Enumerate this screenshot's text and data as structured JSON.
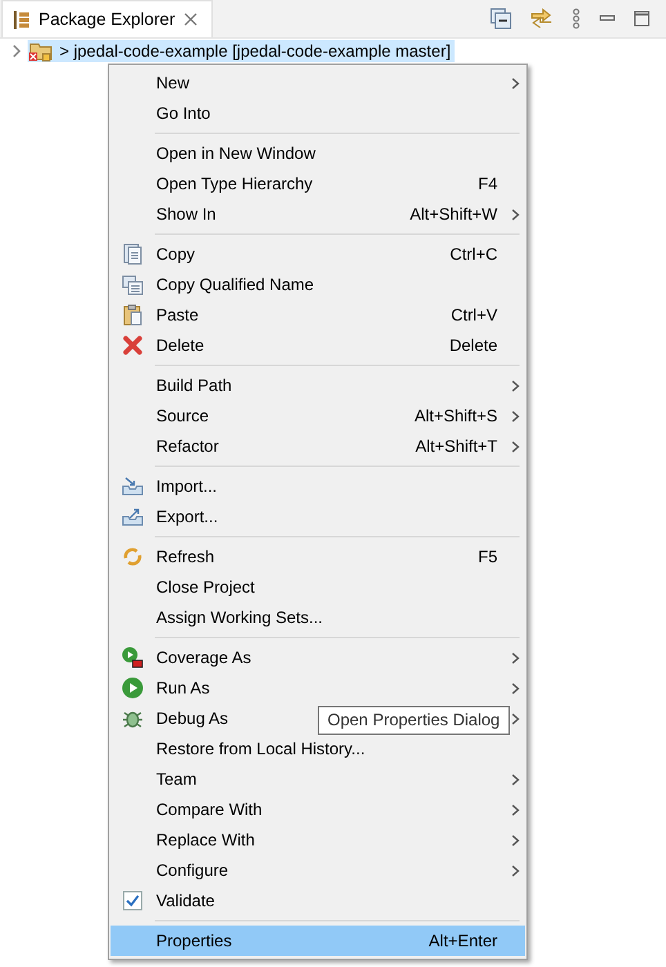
{
  "view": {
    "title": "Package Explorer"
  },
  "tree": [
    {
      "label": "> jpedal-code-example [jpedal-code-example master]",
      "selected": true,
      "expanded": false
    }
  ],
  "menu": {
    "groups": [
      [
        {
          "label": "New",
          "submenu": true,
          "selected": false
        },
        {
          "label": "Go Into",
          "selected": false
        }
      ],
      [
        {
          "label": "Open in New Window",
          "selected": false
        },
        {
          "label": "Open Type Hierarchy",
          "shortcut": "F4",
          "selected": false
        },
        {
          "label": "Show In",
          "shortcut": "Alt+Shift+W",
          "submenu": true,
          "selected": false
        }
      ],
      [
        {
          "label": "Copy",
          "shortcut": "Ctrl+C",
          "kind": "copy",
          "selected": false
        },
        {
          "label": "Copy Qualified Name",
          "kind": "copy-name",
          "selected": false
        },
        {
          "label": "Paste",
          "shortcut": "Ctrl+V",
          "kind": "paste",
          "selected": false
        },
        {
          "label": "Delete",
          "shortcut": "Delete",
          "kind": "delete",
          "selected": false
        }
      ],
      [
        {
          "label": "Build Path",
          "submenu": true,
          "selected": false
        },
        {
          "label": "Source",
          "shortcut": "Alt+Shift+S",
          "submenu": true,
          "selected": false
        },
        {
          "label": "Refactor",
          "shortcut": "Alt+Shift+T",
          "submenu": true,
          "selected": false
        }
      ],
      [
        {
          "label": "Import...",
          "kind": "import",
          "selected": false
        },
        {
          "label": "Export...",
          "kind": "export",
          "selected": false
        }
      ],
      [
        {
          "label": "Refresh",
          "shortcut": "F5",
          "kind": "refresh",
          "selected": false
        },
        {
          "label": "Close Project",
          "selected": false
        },
        {
          "label": "Assign Working Sets...",
          "selected": false
        }
      ],
      [
        {
          "label": "Coverage As",
          "kind": "coverage",
          "submenu": true,
          "selected": false
        },
        {
          "label": "Run As",
          "kind": "run",
          "submenu": true,
          "selected": false
        },
        {
          "label": "Debug As",
          "kind": "debug",
          "submenu": true,
          "selected": false
        },
        {
          "label": "Restore from Local History...",
          "selected": false
        },
        {
          "label": "Team",
          "submenu": true,
          "selected": false
        },
        {
          "label": "Compare With",
          "submenu": true,
          "selected": false
        },
        {
          "label": "Replace With",
          "submenu": true,
          "selected": false
        },
        {
          "label": "Configure",
          "submenu": true,
          "selected": false
        },
        {
          "label": "Validate",
          "checked": true,
          "selected": false
        }
      ],
      [
        {
          "label": "Properties",
          "shortcut": "Alt+Enter",
          "selected": true
        }
      ]
    ]
  },
  "tooltip": "Open Properties Dialog"
}
